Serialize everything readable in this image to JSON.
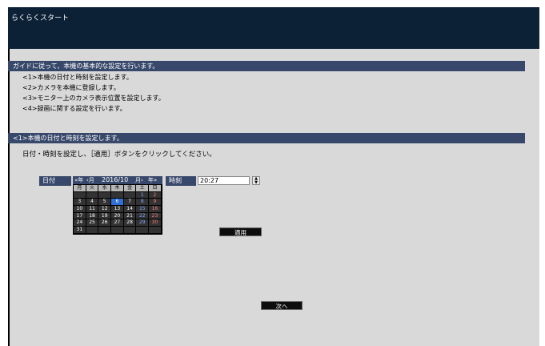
{
  "window": {
    "title": "らくらくスタート"
  },
  "guide": {
    "header": "ガイドに従って、本機の基本的な設定を行います。",
    "steps": [
      "<1>本機の日付と時刻を設定します。",
      "<2>カメラを本機に登録します。",
      "<3>モニター上のカメラ表示位置を設定します。",
      "<4>録画に関する設定を行います。"
    ]
  },
  "section1": {
    "header": "<1>本機の日付と時刻を設定します。",
    "instruction": "日付・時刻を設定し、［適用］ボタンをクリックしてください。"
  },
  "date": {
    "label": "日付",
    "nav": {
      "prev_year": "«年",
      "prev_month": "‹月",
      "current": "2016/10",
      "next_month": "月›",
      "next_year": "年»"
    },
    "weekdays": [
      "月",
      "火",
      "水",
      "木",
      "金",
      "土",
      "日"
    ],
    "weeks": [
      [
        "",
        "",
        "",
        "",
        "",
        "1",
        "2"
      ],
      [
        "3",
        "4",
        "5",
        "6",
        "7",
        "8",
        "9"
      ],
      [
        "10",
        "11",
        "12",
        "13",
        "14",
        "15",
        "16"
      ],
      [
        "17",
        "18",
        "19",
        "20",
        "21",
        "22",
        "23"
      ],
      [
        "24",
        "25",
        "26",
        "27",
        "28",
        "29",
        "30"
      ],
      [
        "31",
        "",
        "",
        "",
        "",
        "",
        ""
      ]
    ],
    "selected_day": "6"
  },
  "time": {
    "label": "時刻",
    "value": "20:27"
  },
  "buttons": {
    "apply": "適用",
    "next": "次へ"
  }
}
